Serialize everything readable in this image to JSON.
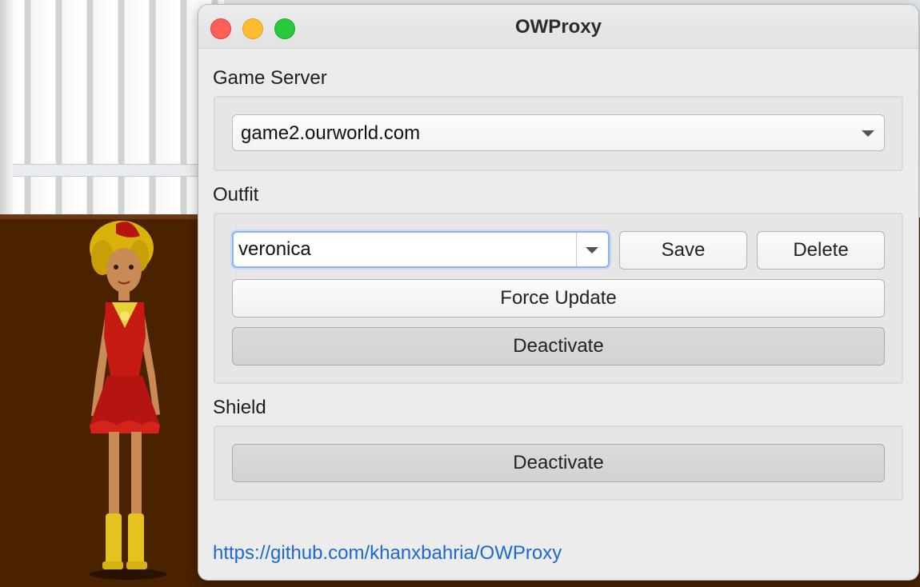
{
  "window": {
    "title": "OWProxy"
  },
  "game_server": {
    "label": "Game Server",
    "selected": "game2.ourworld.com"
  },
  "outfit": {
    "label": "Outfit",
    "name_value": "veronica",
    "save_label": "Save",
    "delete_label": "Delete",
    "force_update_label": "Force Update",
    "deactivate_label": "Deactivate"
  },
  "shield": {
    "label": "Shield",
    "deactivate_label": "Deactivate"
  },
  "footer": {
    "link_text": "https://github.com/khanxbahria/OWProxy"
  },
  "colors": {
    "link": "#1b68d2",
    "close": "#fe5f57",
    "minimize": "#febc2e",
    "maximize": "#28c840"
  }
}
